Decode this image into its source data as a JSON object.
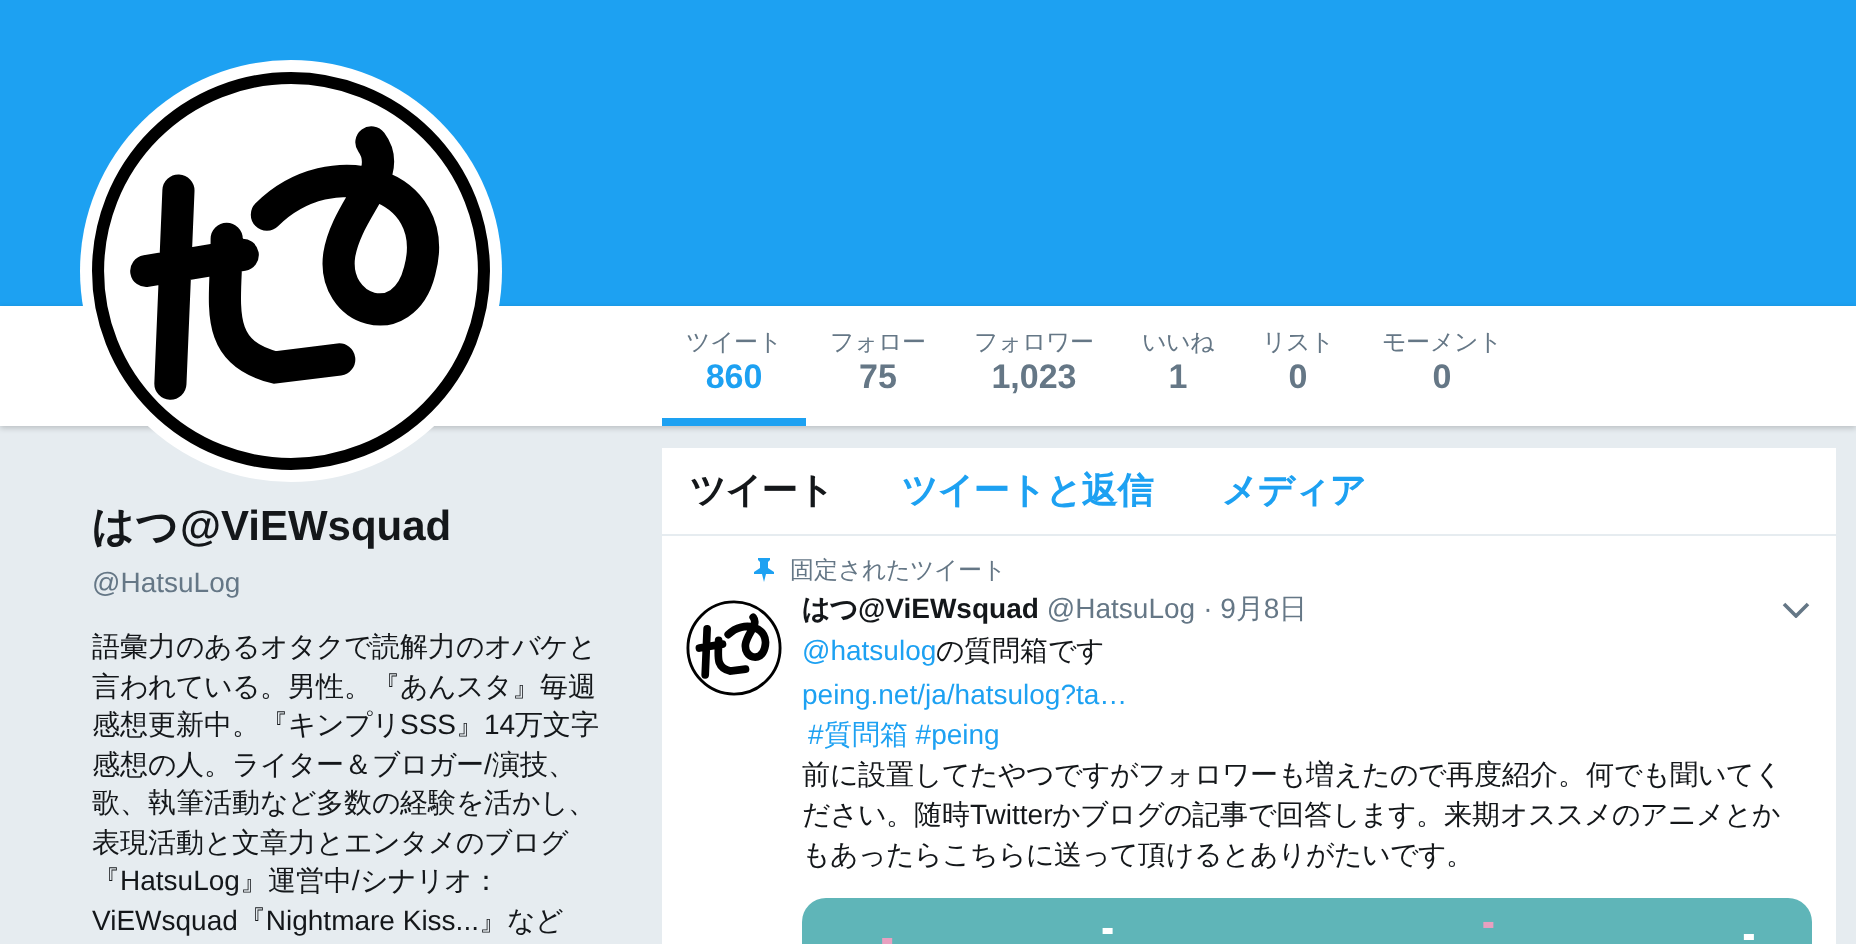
{
  "profile": {
    "name": "はつ@ViEWsquad",
    "handle": "@HatsuLog",
    "bio": "語彙力のあるオタクで読解力のオバケと言われている。男性。『あんスタ』毎週感想更新中。『キンプリSSS』14万文字感想の人。ライター＆ブロガー/演技、歌、執筆活動など多数の経験を活かし、表現活動と文章力とエンタメのブログ『HatsuLog』運営中/シナリオ：ViEWsquad『Nightmare Kiss...』など"
  },
  "stats": [
    {
      "label": "ツイート",
      "value": "860",
      "selected": true
    },
    {
      "label": "フォロー",
      "value": "75",
      "selected": false
    },
    {
      "label": "フォロワー",
      "value": "1,023",
      "selected": false
    },
    {
      "label": "いいね",
      "value": "1",
      "selected": false
    },
    {
      "label": "リスト",
      "value": "0",
      "selected": false
    },
    {
      "label": "モーメント",
      "value": "0",
      "selected": false
    }
  ],
  "timeline_tabs": [
    {
      "label": "ツイート",
      "selected": true
    },
    {
      "label": "ツイートと返信",
      "selected": false
    },
    {
      "label": "メディア",
      "selected": false
    }
  ],
  "pinned_tweet": {
    "pinned_label": "固定されたツイート",
    "author": "はつ@ViEWsquad",
    "handle": "@HatsuLog",
    "time": "· 9月8日",
    "mention": "@hatsulog",
    "mention_rest": "の質問箱です",
    "link": "peing.net/ja/hatsulog?ta…",
    "hashtags": [
      "#質問箱",
      "#peing"
    ],
    "body": "前に設置してたやつですがフォロワーも増えたので再度紹介。何でも聞いてください。随時Twitterかブログの記事で回答します。来期オススメのアニメとかもあったらこちらに送って頂けるとありがたいです。",
    "media": {
      "kind": "picture"
    }
  }
}
